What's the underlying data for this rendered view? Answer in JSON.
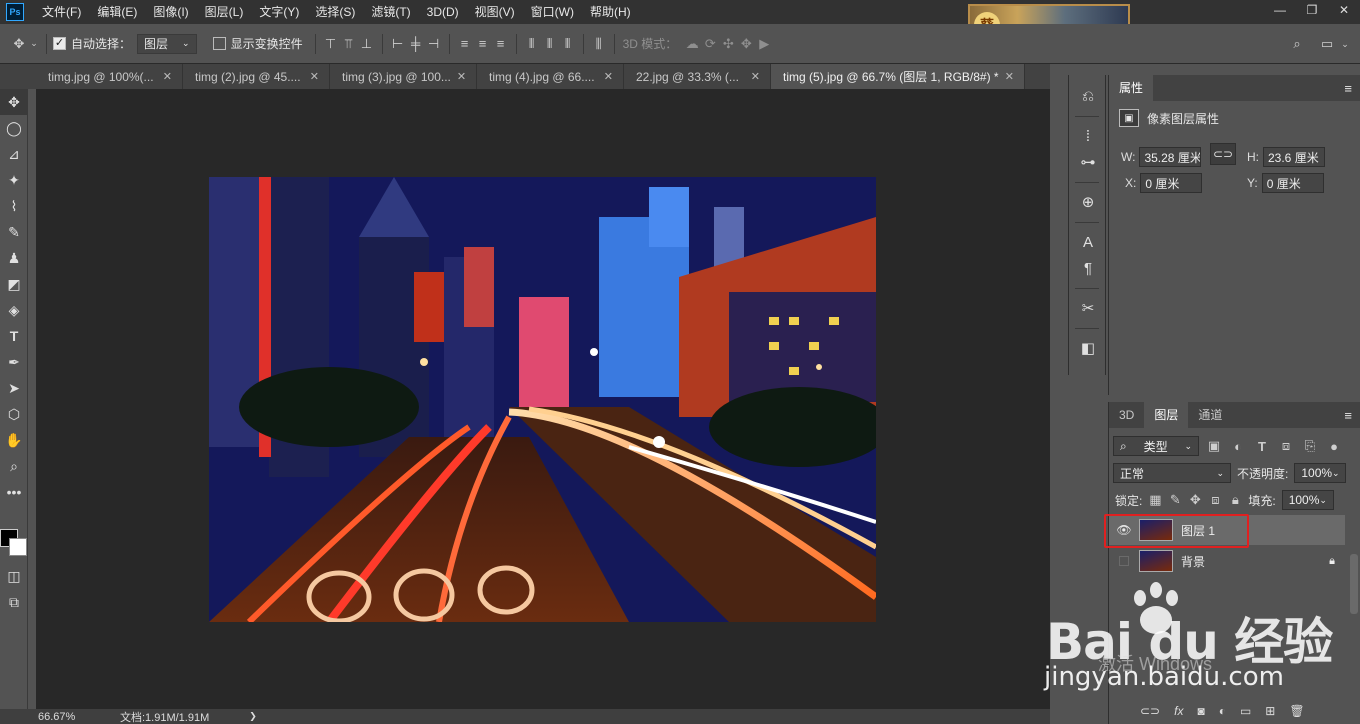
{
  "app": {
    "logo": "Ps"
  },
  "menu": [
    "文件(F)",
    "编辑(E)",
    "图像(I)",
    "图层(L)",
    "文字(Y)",
    "选择(S)",
    "滤镜(T)",
    "3D(D)",
    "视图(V)",
    "窗口(W)",
    "帮助(H)"
  ],
  "banner": {
    "badge": "葵"
  },
  "window_controls": {
    "minimize": "—",
    "restore": "❐",
    "close": "✕"
  },
  "options": {
    "auto_select_label": "自动选择：",
    "auto_select_value": "图层",
    "show_transform_label": "显示变换控件",
    "mode_3d_label": "3D 模式："
  },
  "tabs": [
    {
      "label": "timg.jpg @ 100%(...",
      "active": false
    },
    {
      "label": "timg (2).jpg @ 45....",
      "active": false
    },
    {
      "label": "timg (3).jpg @ 100...",
      "active": false
    },
    {
      "label": "timg (4).jpg @ 66....",
      "active": false
    },
    {
      "label": "22.jpg @ 33.3% (...",
      "active": false
    },
    {
      "label": "timg (5).jpg @ 66.7% (图层 1, RGB/8#) *",
      "active": true
    }
  ],
  "status": {
    "zoom": "66.67%",
    "doc": "文档:1.91M/1.91M",
    "arrow": "❯"
  },
  "properties": {
    "tab": "属性",
    "title": "像素图层属性",
    "w_label": "W:",
    "w_value": "35.28 厘米",
    "h_label": "H:",
    "h_value": "23.6 厘米",
    "x_label": "X:",
    "x_value": "0 厘米",
    "y_label": "Y:",
    "y_value": "0 厘米"
  },
  "layers_panel": {
    "tabs": [
      "3D",
      "图层",
      "通道"
    ],
    "active_tab": "图层",
    "filter_label": "类型",
    "blend_mode": "正常",
    "opacity_label": "不透明度:",
    "opacity_value": "100%",
    "lock_label": "锁定:",
    "fill_label": "填充:",
    "fill_value": "100%",
    "layers": [
      {
        "name": "图层 1",
        "visible": true,
        "selected": true,
        "locked": false
      },
      {
        "name": "背景",
        "visible": false,
        "selected": false,
        "locked": true
      }
    ]
  },
  "watermark": {
    "logo_text": "Bai du 经验",
    "site": "jingyan.baidu.com",
    "activate": "激活 Windows"
  },
  "colors": {
    "highlight": "#e02020",
    "canvas_bg": "#282828",
    "panel_bg": "#535353"
  }
}
